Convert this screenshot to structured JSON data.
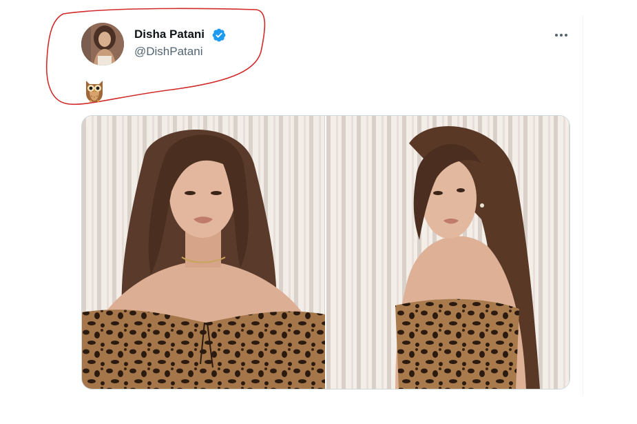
{
  "tweet": {
    "author": {
      "display_name": "Disha Patani",
      "handle": "@DishPatani",
      "verified": true,
      "avatar_icon": "profile-photo"
    },
    "text_emoji": "owl-emoji",
    "more_icon": "more-horizontal-icon",
    "media": [
      {
        "kind": "photo",
        "description_icon": "photo-1"
      },
      {
        "kind": "photo",
        "description_icon": "photo-2"
      }
    ]
  },
  "colors": {
    "name": "#0f1419",
    "handle": "#536471",
    "verified": "#1d9bf0",
    "annotation": "#d12a2a",
    "border": "#cfd9de"
  }
}
